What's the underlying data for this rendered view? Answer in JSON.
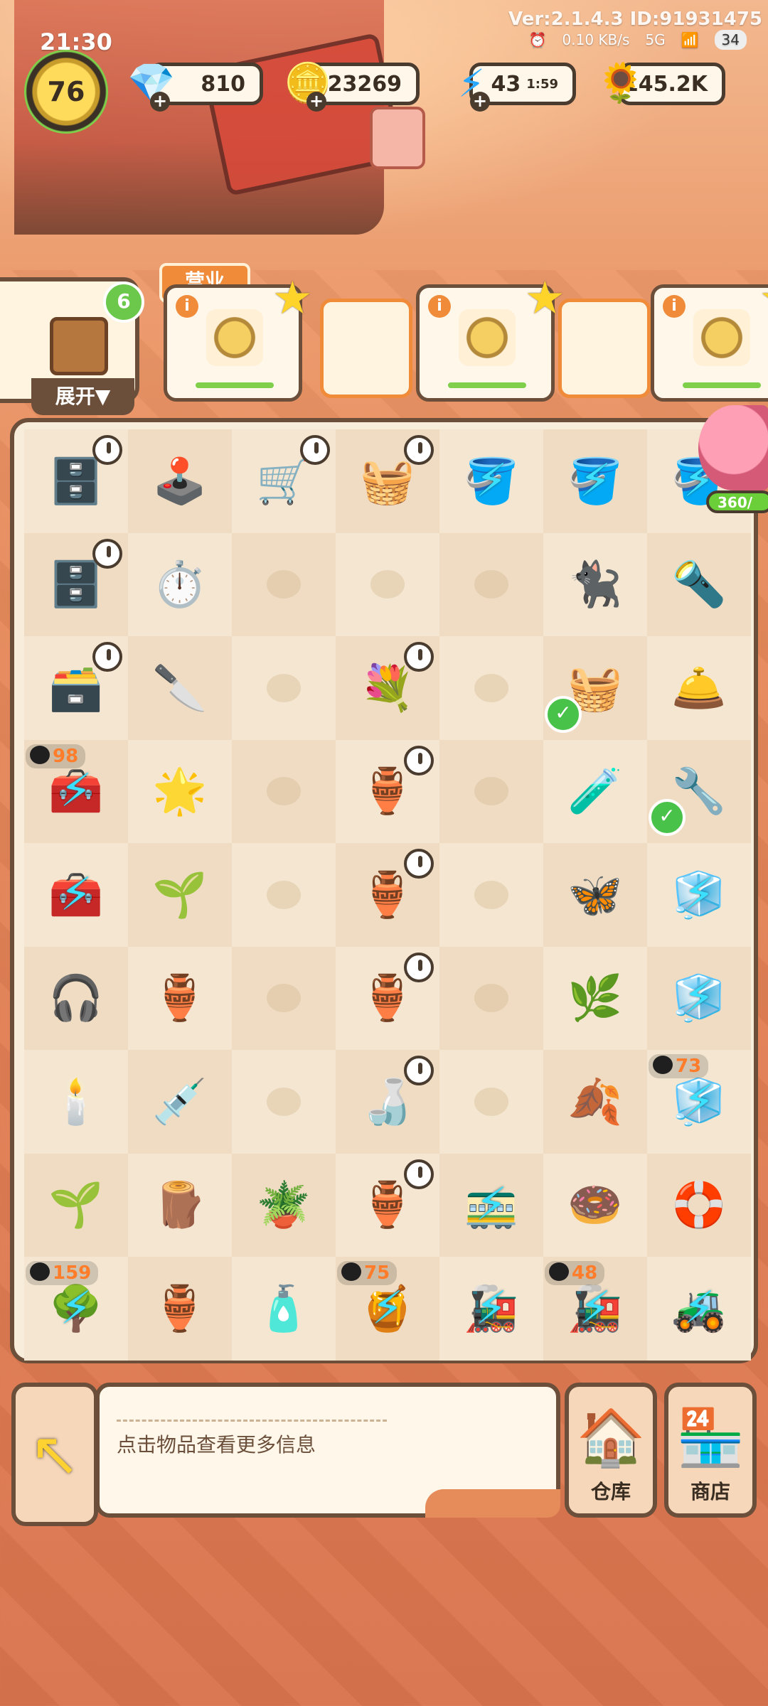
{
  "statusbar": {
    "time": "21:30",
    "version": "Ver:2.1.4.3 ID:91931475",
    "net_speed": "0.10 KB/s",
    "battery": "34",
    "signal": "5G"
  },
  "resources": {
    "level": "76",
    "gems": "810",
    "coins": "23269",
    "energy": "43",
    "energy_timer": "1:59",
    "seeds": "145.2K"
  },
  "orders": {
    "open_label": "营业",
    "left_badge": "6",
    "expand_label": "展开▼",
    "cards": [
      {
        "id": "order-1"
      },
      {
        "id": "order-2"
      },
      {
        "id": "order-3"
      }
    ]
  },
  "board": {
    "cells": [
      {
        "icon": "🗄️",
        "timer": true
      },
      {
        "icon": "🕹️"
      },
      {
        "icon": "🛒",
        "timer": true
      },
      {
        "icon": "🧺",
        "timer": true
      },
      {
        "icon": "🪣",
        "bolt": true
      },
      {
        "icon": "🪣",
        "bolt": true
      },
      {
        "icon": "🪣",
        "bolt": true
      },
      {
        "icon": "🗄️",
        "timer": true
      },
      {
        "icon": "⏱️"
      },
      {
        "icon": ""
      },
      {
        "icon": ""
      },
      {
        "icon": ""
      },
      {
        "icon": "🐈‍⬛"
      },
      {
        "icon": "🔦"
      },
      {
        "icon": "🗃️",
        "timer": true
      },
      {
        "icon": "🔪"
      },
      {
        "icon": ""
      },
      {
        "icon": "💐",
        "timer": true
      },
      {
        "icon": ""
      },
      {
        "icon": "🧺",
        "check": true
      },
      {
        "icon": "🛎️"
      },
      {
        "icon": "🧰",
        "cat": "98",
        "bolt": true
      },
      {
        "icon": "🌟"
      },
      {
        "icon": ""
      },
      {
        "icon": "🏺",
        "timer": true
      },
      {
        "icon": ""
      },
      {
        "icon": "🧪"
      },
      {
        "icon": "🔧",
        "check": true
      },
      {
        "icon": "🧰",
        "bolt": true
      },
      {
        "icon": "🌱"
      },
      {
        "icon": ""
      },
      {
        "icon": "🏺",
        "timer": true
      },
      {
        "icon": ""
      },
      {
        "icon": "🦋"
      },
      {
        "icon": "🧊",
        "bolt": true
      },
      {
        "icon": "🎧"
      },
      {
        "icon": "🏺"
      },
      {
        "icon": ""
      },
      {
        "icon": "🏺",
        "timer": true
      },
      {
        "icon": ""
      },
      {
        "icon": "🌿"
      },
      {
        "icon": "🧊",
        "bolt": true
      },
      {
        "icon": "🕯️"
      },
      {
        "icon": "💉"
      },
      {
        "icon": ""
      },
      {
        "icon": "🍶",
        "timer": true
      },
      {
        "icon": ""
      },
      {
        "icon": "🍂"
      },
      {
        "icon": "🧊",
        "cat": "73",
        "bolt": true
      },
      {
        "icon": "🌱"
      },
      {
        "icon": "🪵"
      },
      {
        "icon": "🪴"
      },
      {
        "icon": "🏺",
        "timer": true
      },
      {
        "icon": "🚃",
        "bolt": true
      },
      {
        "icon": "🍩"
      },
      {
        "icon": "🛟"
      },
      {
        "icon": "🌳",
        "cat": "159",
        "bolt": true
      },
      {
        "icon": "🏺"
      },
      {
        "icon": "🧴"
      },
      {
        "icon": "🍯",
        "cat": "75",
        "bolt": true
      },
      {
        "icon": "🚂",
        "bolt": true
      },
      {
        "icon": "🚂",
        "cat": "48",
        "bolt": true
      },
      {
        "icon": "🚜",
        "bolt": true
      }
    ]
  },
  "piggy": {
    "progress": "360/"
  },
  "bottom": {
    "info_text": "点击物品查看更多信息",
    "warehouse_label": "仓库",
    "shop_label": "商店"
  }
}
